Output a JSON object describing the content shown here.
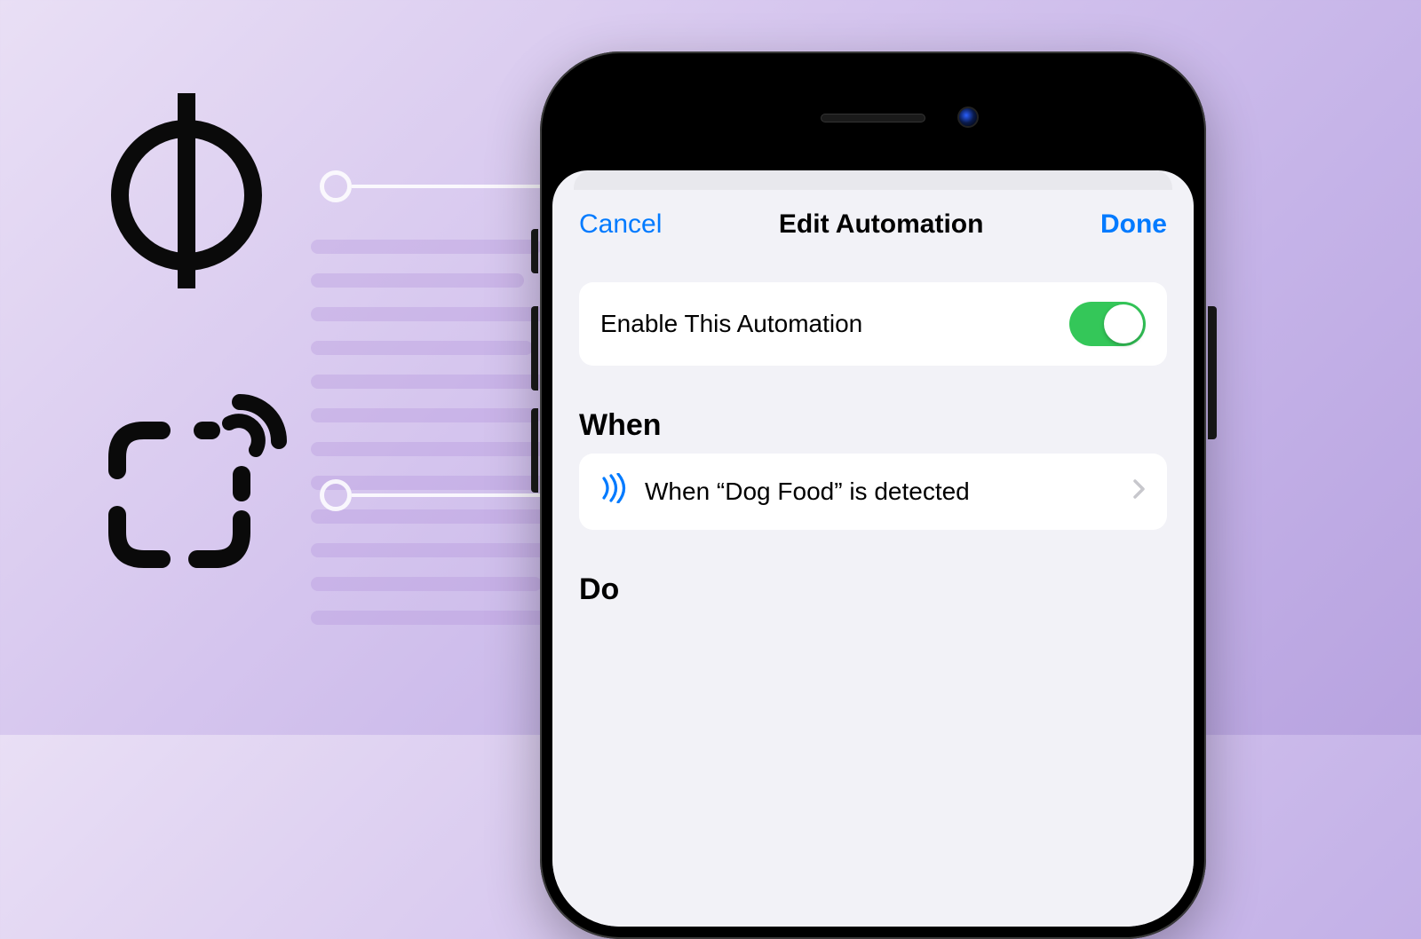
{
  "nav": {
    "cancel": "Cancel",
    "title": "Edit Automation",
    "done": "Done"
  },
  "enable_row": {
    "label": "Enable This Automation",
    "enabled": true
  },
  "sections": {
    "when": {
      "header": "When",
      "trigger_text": "When “Dog Food” is detected"
    },
    "do": {
      "header": "Do"
    }
  },
  "colors": {
    "ios_blue": "#007aff",
    "ios_green": "#34c759",
    "sheet_bg": "#f2f2f7"
  }
}
